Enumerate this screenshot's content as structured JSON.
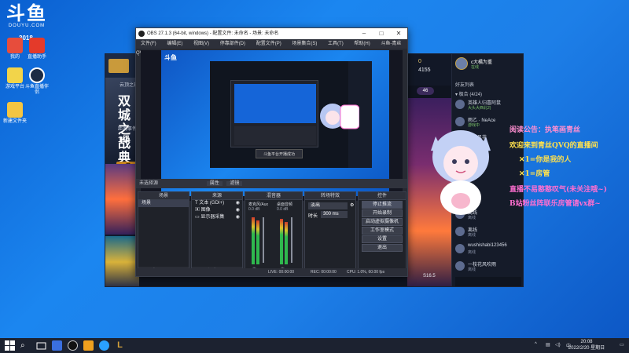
{
  "desktop": {
    "logo": {
      "glyph": "斗鱼",
      "sub": "DOUYU.COM"
    },
    "room_badge": "3018",
    "icons": [
      {
        "label": "我的",
        "color": "#e74d3c"
      },
      {
        "label": "直播助手",
        "color": "#e43a2a"
      },
      {
        "label": "游戏平台",
        "color": "#f2d44a"
      },
      {
        "label": "斗鱼直播伴侣",
        "color": "#1b2b44"
      },
      {
        "label": "新建文件夹",
        "color": "#f4c542"
      }
    ]
  },
  "game_client": {
    "title": "双城之战 典",
    "event_text": "距离事件",
    "level": "1级",
    "left_tag": "云顶之弈",
    "orange_button": "开",
    "currency_1": "0",
    "currency_2": "4155",
    "chip": "46",
    "season": "S16.5",
    "user": {
      "name": "c大橘为重",
      "status": "在线"
    },
    "friends_header": "好友列表",
    "group_header": "▾ 极合 (4/24)",
    "friends": [
      {
        "name": "英雄人归喜阿鼠",
        "status": "大头大西北2)",
        "online": true
      },
      {
        "name": "雨乙 · NeAce",
        "status": "游戏中",
        "online": true
      },
      {
        "name": "雪月风花",
        "status": "在线",
        "online": true
      },
      {
        "name": "离线",
        "status": "离线",
        "online": false
      },
      {
        "name": "离线",
        "status": "离线",
        "online": false
      },
      {
        "name": "wushishabi123456",
        "status": "离线",
        "online": false
      },
      {
        "name": "一枝花风吹雨",
        "status": "离线",
        "online": false
      }
    ]
  },
  "obs": {
    "title": "OBS 27.1.3 (64-bit, windows) - 配置文件: 未命名 - 场景: 未命名",
    "menu": [
      "文件(F)",
      "编辑(E)",
      "视图(V)",
      "停靠部件(D)",
      "配置文件(P)",
      "场景集合(S)",
      "工具(T)",
      "帮助(H)",
      "斗鱼-青丝QVQ"
    ],
    "preview_toast": "斗鱼平台开播成功",
    "status_strip": "未选择源",
    "strip_buttons": [
      "属性",
      "滤镜"
    ],
    "docks": {
      "scenes": {
        "title": "场景",
        "items": [
          "场景"
        ]
      },
      "sources": {
        "title": "来源",
        "items": [
          "文本 (GDI+)",
          "图像",
          "显示器采集"
        ]
      },
      "mixer": {
        "title": "混音器",
        "channels": [
          {
            "name": "麦克风/Aux",
            "db": "0.0 dB"
          },
          {
            "name": "桌面音频",
            "db": "0.0 dB"
          }
        ]
      },
      "transitions": {
        "title": "转场特效",
        "type_label": "淡出",
        "duration_label": "时长",
        "duration": "300 ms"
      },
      "controls": {
        "title": "控件",
        "buttons": [
          "停止推流",
          "开始录制",
          "启动虚拟摄像机",
          "工作室模式",
          "设置",
          "退出"
        ]
      }
    },
    "bottom": {
      "live": "LIVE: 00:00:00",
      "rec": "REC: 00:00:00",
      "cpu": "CPU: 1.0%, 60.00 fps"
    }
  },
  "overlay": {
    "lines": [
      {
        "text": "阅读公告：执笔画青丝",
        "color": "#ff8fd1"
      },
      {
        "text": "欢迎来到青丝QVQ的直播间",
        "color": "#ffe14d"
      },
      {
        "text": "✕1=你是我的人",
        "color": "#ffe14d"
      },
      {
        "text": "✕1=房管",
        "color": "#ffe14d"
      },
      {
        "text": "直播不易憨憨叹气(未关注哦~)",
        "color": "#ff6fd1"
      },
      {
        "text": "B站粉丝阵联乐房管请vx群~",
        "color": "#ff6fd1"
      }
    ]
  },
  "taskbar": {
    "time": "20:08",
    "date": "2022/2/20 星期日",
    "lang": "中"
  }
}
